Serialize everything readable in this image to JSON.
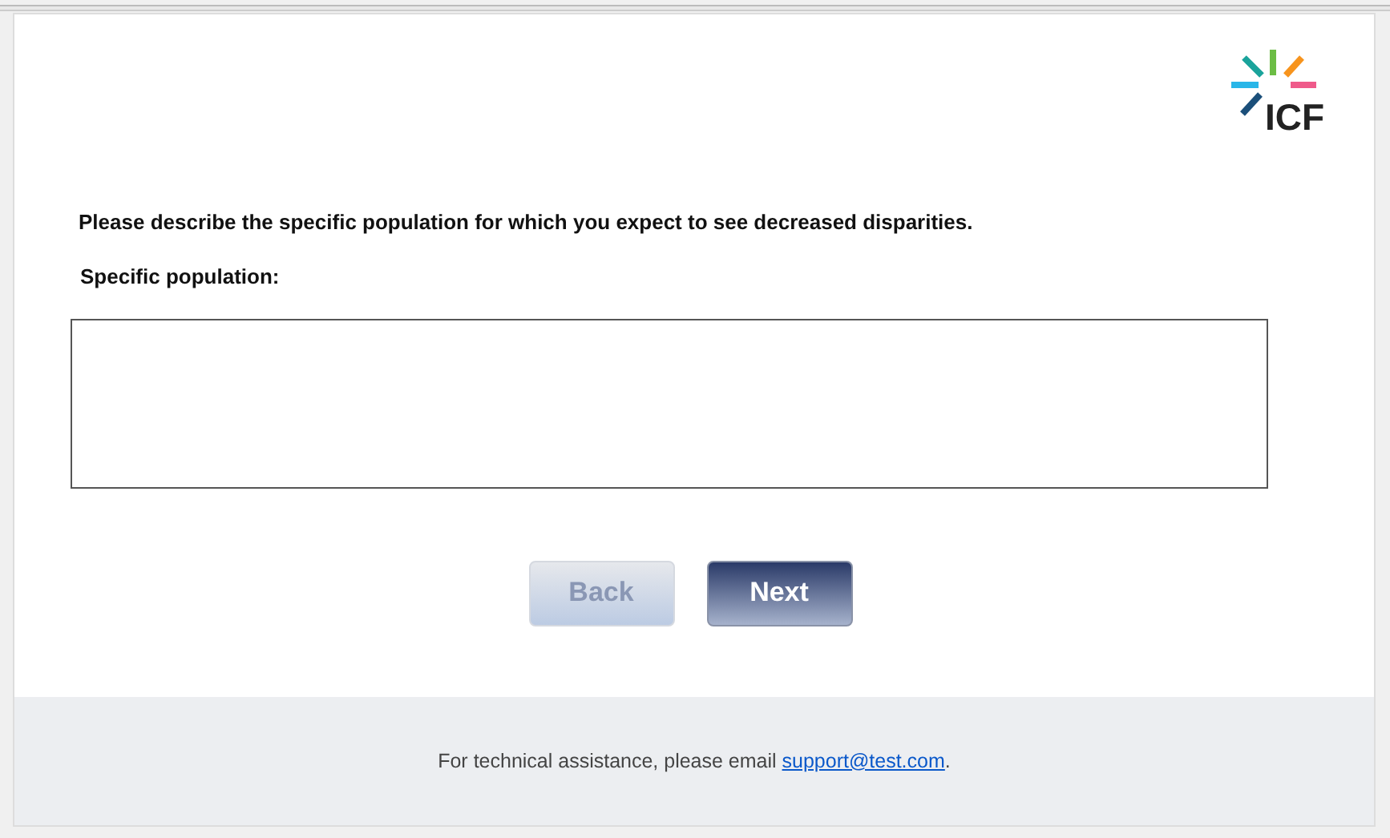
{
  "logo": {
    "text": "ICF"
  },
  "question": "Please describe the specific population for which you expect to see decreased disparities.",
  "field": {
    "label": "Specific population:"
  },
  "buttons": [
    {
      "label": "Back",
      "disabled": true
    },
    {
      "label": "Next",
      "disabled": false
    }
  ],
  "footer": {
    "text_before": "For technical assistance, please email ",
    "link": "support@test.com",
    "text_after": "."
  }
}
